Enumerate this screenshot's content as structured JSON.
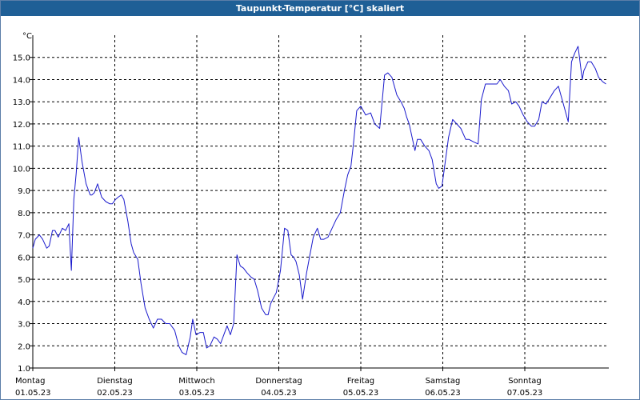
{
  "window": {
    "title": "Taupunkt-Temperatur [°C] skaliert"
  },
  "chart_data": {
    "type": "line",
    "title": "Taupunkt-Temperatur [°C] skaliert",
    "ylabel": "°C",
    "xlabel": "",
    "ylim": [
      1.0,
      16.0
    ],
    "xlim": [
      0,
      7
    ],
    "grid": true,
    "y_ticks": [
      "1.0",
      "2.0",
      "3.0",
      "4.0",
      "5.0",
      "6.0",
      "7.0",
      "8.0",
      "9.0",
      "10.0",
      "11.0",
      "12.0",
      "13.0",
      "14.0",
      "15.0"
    ],
    "x_ticks": [
      {
        "day": "Montag",
        "date": "01.05.23"
      },
      {
        "day": "Dienstag",
        "date": "02.05.23"
      },
      {
        "day": "Mittwoch",
        "date": "03.05.23"
      },
      {
        "day": "Donnerstag",
        "date": "04.05.23"
      },
      {
        "day": "Freitag",
        "date": "05.05.23"
      },
      {
        "day": "Samstag",
        "date": "06.05.23"
      },
      {
        "day": "Sonntag",
        "date": "07.05.23"
      }
    ],
    "line_color": "#1a1acc",
    "series": [
      {
        "x": [
          0.0,
          0.03,
          0.08,
          0.12,
          0.17,
          0.2,
          0.24,
          0.27,
          0.31,
          0.36,
          0.4,
          0.44,
          0.47,
          0.5,
          0.53,
          0.56,
          0.6,
          0.65,
          0.7,
          0.72,
          0.75,
          0.79,
          0.84,
          0.89,
          0.94,
          0.97,
          1.01,
          1.04,
          1.08,
          1.11,
          1.16,
          1.2,
          1.23,
          1.28,
          1.32,
          1.37,
          1.42,
          1.47,
          1.52,
          1.57,
          1.62,
          1.67,
          1.73,
          1.78,
          1.82,
          1.87,
          1.92,
          1.95,
          1.99,
          2.04,
          2.08,
          2.12,
          2.16,
          2.21,
          2.25,
          2.29,
          2.33,
          2.37,
          2.41,
          2.45,
          2.49,
          2.53,
          2.57,
          2.61,
          2.66,
          2.7,
          2.74,
          2.79,
          2.84,
          2.87,
          2.9,
          2.94,
          2.97,
          3.02,
          3.07,
          3.11,
          3.15,
          3.18,
          3.21,
          3.25,
          3.29,
          3.34,
          3.38,
          3.42,
          3.47,
          3.51,
          3.55,
          3.6,
          3.65,
          3.7,
          3.75,
          3.8,
          3.84,
          3.88,
          3.91,
          3.95,
          4.0,
          4.06,
          4.12,
          4.17,
          4.23,
          4.29,
          4.33,
          4.38,
          4.44,
          4.49,
          4.53,
          4.56,
          4.59,
          4.62,
          4.66,
          4.69,
          4.73,
          4.78,
          4.83,
          4.87,
          4.92,
          4.95,
          4.99,
          5.03,
          5.07,
          5.12,
          5.17,
          5.22,
          5.28,
          5.32,
          5.37,
          5.43,
          5.47,
          5.52,
          5.57,
          5.62,
          5.66,
          5.7,
          5.75,
          5.8,
          5.84,
          5.89,
          5.93,
          5.98,
          6.03,
          6.08,
          6.12,
          6.17,
          6.21,
          6.26,
          6.31,
          6.36,
          6.41,
          6.47,
          6.53,
          6.57,
          6.61,
          6.65,
          6.7,
          6.72,
          6.77,
          6.81,
          6.86,
          6.9,
          6.95,
          6.99
        ],
        "y": [
          6.4,
          6.8,
          7.0,
          6.8,
          6.4,
          6.5,
          7.2,
          7.2,
          6.9,
          7.3,
          7.2,
          7.5,
          5.4,
          8.6,
          9.8,
          11.4,
          10.3,
          9.3,
          8.8,
          8.8,
          8.9,
          9.3,
          8.7,
          8.5,
          8.4,
          8.4,
          8.6,
          8.7,
          8.8,
          8.6,
          7.6,
          6.6,
          6.2,
          5.9,
          4.8,
          3.7,
          3.2,
          2.8,
          3.2,
          3.2,
          3.0,
          3.0,
          2.7,
          2.0,
          1.7,
          1.6,
          2.4,
          3.2,
          2.5,
          2.6,
          2.6,
          1.9,
          2.0,
          2.4,
          2.3,
          2.1,
          2.5,
          2.9,
          2.5,
          3.0,
          6.1,
          5.6,
          5.5,
          5.3,
          5.1,
          5.0,
          4.5,
          3.7,
          3.4,
          3.4,
          3.9,
          4.2,
          4.4,
          5.4,
          7.3,
          7.2,
          6.1,
          6.0,
          5.8,
          5.2,
          4.1,
          5.3,
          6.1,
          6.9,
          7.3,
          6.8,
          6.8,
          6.9,
          7.3,
          7.7,
          8.0,
          9.0,
          9.7,
          10.1,
          11.1,
          12.6,
          12.8,
          12.4,
          12.5,
          12.0,
          11.8,
          14.2,
          14.3,
          14.1,
          13.3,
          13.0,
          12.7,
          12.3,
          12.0,
          11.5,
          10.8,
          11.3,
          11.3,
          11.0,
          10.8,
          10.4,
          9.3,
          9.1,
          9.2,
          10.3,
          11.4,
          12.2,
          12.0,
          11.8,
          11.3,
          11.3,
          11.2,
          11.1,
          13.1,
          13.8,
          13.8,
          13.8,
          13.8,
          14.0,
          13.7,
          13.5,
          12.9,
          13.0,
          12.8,
          12.4,
          12.1,
          11.9,
          11.9,
          12.2,
          13.0,
          12.9,
          13.2,
          13.5,
          13.7,
          12.9,
          12.1,
          14.8,
          15.2,
          15.5,
          14.0,
          14.4,
          14.8,
          14.8,
          14.5,
          14.1,
          13.9,
          13.8
        ]
      }
    ]
  }
}
